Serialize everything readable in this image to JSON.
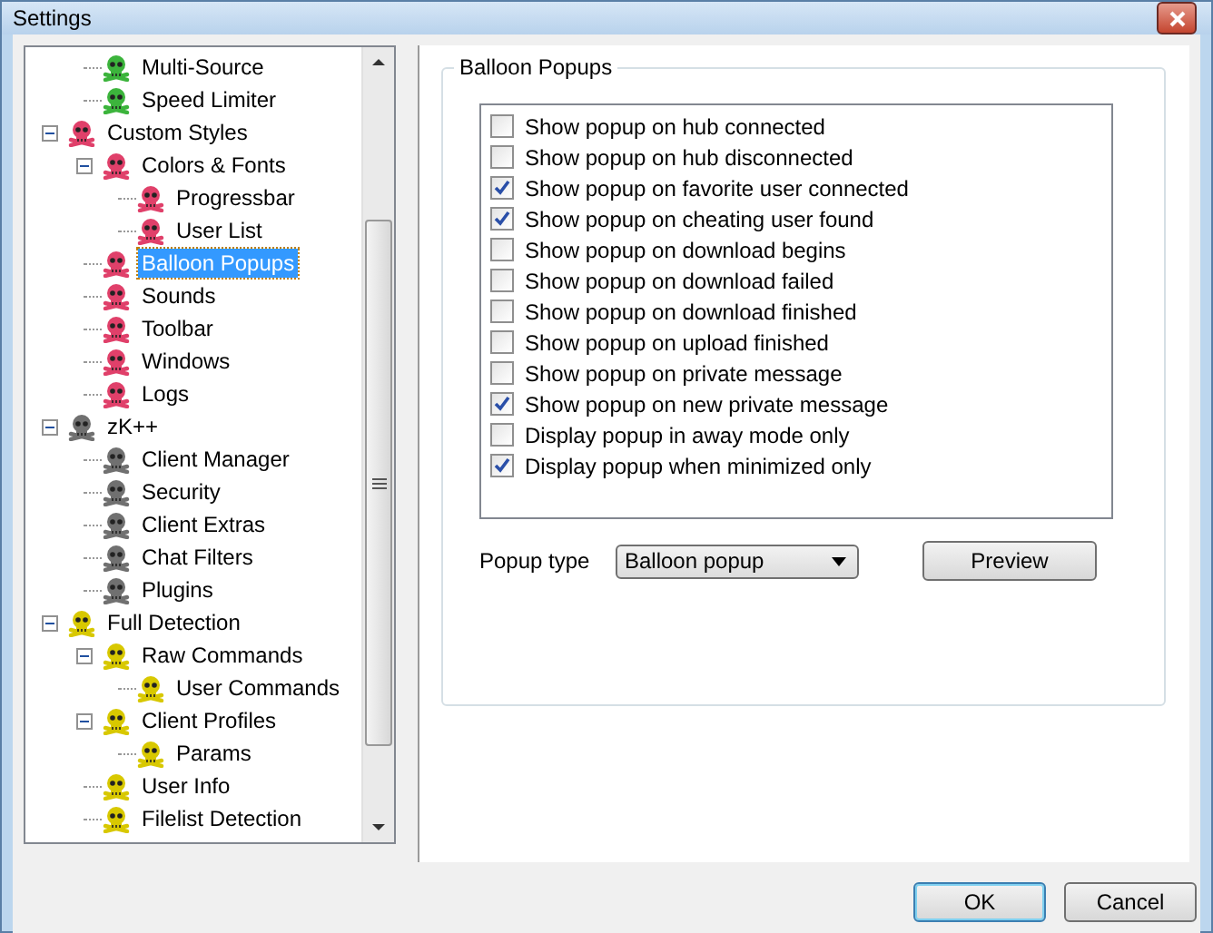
{
  "window": {
    "title": "Settings"
  },
  "tree": {
    "continued_children": [
      {
        "label": "Multi-Source",
        "color": "#3cb43c",
        "selected": false
      },
      {
        "label": "Speed Limiter",
        "color": "#3cb43c",
        "selected": false
      }
    ],
    "items": [
      {
        "label": "Custom Styles",
        "color": "#e0406a",
        "selected": false,
        "expanded": true,
        "children": [
          {
            "label": "Colors & Fonts",
            "color": "#e0406a",
            "selected": false,
            "expanded": true,
            "children": [
              {
                "label": "Progressbar",
                "color": "#e0406a",
                "selected": false
              },
              {
                "label": "User List",
                "color": "#e0406a",
                "selected": false
              }
            ]
          },
          {
            "label": "Balloon Popups",
            "color": "#e0406a",
            "selected": true
          },
          {
            "label": "Sounds",
            "color": "#e0406a",
            "selected": false
          },
          {
            "label": "Toolbar",
            "color": "#e0406a",
            "selected": false
          },
          {
            "label": "Windows",
            "color": "#e0406a",
            "selected": false
          },
          {
            "label": "Logs",
            "color": "#e0406a",
            "selected": false
          }
        ]
      },
      {
        "label": "zK++",
        "color": "#707070",
        "selected": false,
        "expanded": true,
        "children": [
          {
            "label": "Client Manager",
            "color": "#707070",
            "selected": false
          },
          {
            "label": "Security",
            "color": "#707070",
            "selected": false
          },
          {
            "label": "Client Extras",
            "color": "#707070",
            "selected": false
          },
          {
            "label": "Chat Filters",
            "color": "#707070",
            "selected": false
          },
          {
            "label": "Plugins",
            "color": "#707070",
            "selected": false
          }
        ]
      },
      {
        "label": "Full Detection",
        "color": "#d8c800",
        "selected": false,
        "expanded": true,
        "children": [
          {
            "label": "Raw Commands",
            "color": "#d8c800",
            "selected": false,
            "expanded": true,
            "children": [
              {
                "label": "User Commands",
                "color": "#d8c800",
                "selected": false
              }
            ]
          },
          {
            "label": "Client Profiles",
            "color": "#d8c800",
            "selected": false,
            "expanded": true,
            "children": [
              {
                "label": "Params",
                "color": "#d8c800",
                "selected": false
              }
            ]
          },
          {
            "label": "User Info",
            "color": "#d8c800",
            "selected": false
          },
          {
            "label": "Filelist Detection",
            "color": "#d8c800",
            "selected": false
          }
        ]
      }
    ]
  },
  "group": {
    "title": "Balloon Popups",
    "options": [
      {
        "label": "Show popup on hub connected",
        "checked": false
      },
      {
        "label": "Show popup on hub disconnected",
        "checked": false
      },
      {
        "label": "Show popup on favorite user connected",
        "checked": true
      },
      {
        "label": "Show popup on cheating user found",
        "checked": true
      },
      {
        "label": "Show popup on download begins",
        "checked": false
      },
      {
        "label": "Show popup on download failed",
        "checked": false
      },
      {
        "label": "Show popup on download finished",
        "checked": false
      },
      {
        "label": "Show popup on upload finished",
        "checked": false
      },
      {
        "label": "Show popup on private message",
        "checked": false
      },
      {
        "label": "Show popup on new private message",
        "checked": true
      },
      {
        "label": "Display popup in away mode only",
        "checked": false
      },
      {
        "label": "Display popup when minimized only",
        "checked": true
      }
    ],
    "popup_type": {
      "label": "Popup type",
      "value": "Balloon popup"
    },
    "preview_button": "Preview"
  },
  "buttons": [
    {
      "label": "OK",
      "default": true
    },
    {
      "label": "Cancel",
      "default": false
    }
  ]
}
